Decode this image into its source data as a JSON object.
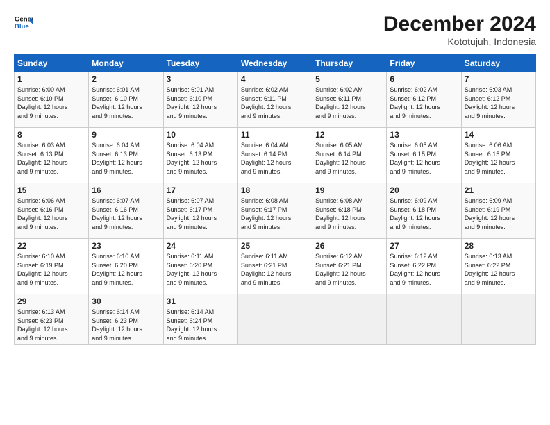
{
  "header": {
    "logo_line1": "General",
    "logo_line2": "Blue",
    "month": "December 2024",
    "location": "Kototujuh, Indonesia"
  },
  "days_of_week": [
    "Sunday",
    "Monday",
    "Tuesday",
    "Wednesday",
    "Thursday",
    "Friday",
    "Saturday"
  ],
  "weeks": [
    [
      {
        "num": "1",
        "sr": "6:00 AM",
        "ss": "6:10 PM",
        "dl": "12 hours and 9 minutes."
      },
      {
        "num": "2",
        "sr": "6:01 AM",
        "ss": "6:10 PM",
        "dl": "12 hours and 9 minutes."
      },
      {
        "num": "3",
        "sr": "6:01 AM",
        "ss": "6:10 PM",
        "dl": "12 hours and 9 minutes."
      },
      {
        "num": "4",
        "sr": "6:02 AM",
        "ss": "6:11 PM",
        "dl": "12 hours and 9 minutes."
      },
      {
        "num": "5",
        "sr": "6:02 AM",
        "ss": "6:11 PM",
        "dl": "12 hours and 9 minutes."
      },
      {
        "num": "6",
        "sr": "6:02 AM",
        "ss": "6:12 PM",
        "dl": "12 hours and 9 minutes."
      },
      {
        "num": "7",
        "sr": "6:03 AM",
        "ss": "6:12 PM",
        "dl": "12 hours and 9 minutes."
      }
    ],
    [
      {
        "num": "8",
        "sr": "6:03 AM",
        "ss": "6:13 PM",
        "dl": "12 hours and 9 minutes."
      },
      {
        "num": "9",
        "sr": "6:04 AM",
        "ss": "6:13 PM",
        "dl": "12 hours and 9 minutes."
      },
      {
        "num": "10",
        "sr": "6:04 AM",
        "ss": "6:13 PM",
        "dl": "12 hours and 9 minutes."
      },
      {
        "num": "11",
        "sr": "6:04 AM",
        "ss": "6:14 PM",
        "dl": "12 hours and 9 minutes."
      },
      {
        "num": "12",
        "sr": "6:05 AM",
        "ss": "6:14 PM",
        "dl": "12 hours and 9 minutes."
      },
      {
        "num": "13",
        "sr": "6:05 AM",
        "ss": "6:15 PM",
        "dl": "12 hours and 9 minutes."
      },
      {
        "num": "14",
        "sr": "6:06 AM",
        "ss": "6:15 PM",
        "dl": "12 hours and 9 minutes."
      }
    ],
    [
      {
        "num": "15",
        "sr": "6:06 AM",
        "ss": "6:16 PM",
        "dl": "12 hours and 9 minutes."
      },
      {
        "num": "16",
        "sr": "6:07 AM",
        "ss": "6:16 PM",
        "dl": "12 hours and 9 minutes."
      },
      {
        "num": "17",
        "sr": "6:07 AM",
        "ss": "6:17 PM",
        "dl": "12 hours and 9 minutes."
      },
      {
        "num": "18",
        "sr": "6:08 AM",
        "ss": "6:17 PM",
        "dl": "12 hours and 9 minutes."
      },
      {
        "num": "19",
        "sr": "6:08 AM",
        "ss": "6:18 PM",
        "dl": "12 hours and 9 minutes."
      },
      {
        "num": "20",
        "sr": "6:09 AM",
        "ss": "6:18 PM",
        "dl": "12 hours and 9 minutes."
      },
      {
        "num": "21",
        "sr": "6:09 AM",
        "ss": "6:19 PM",
        "dl": "12 hours and 9 minutes."
      }
    ],
    [
      {
        "num": "22",
        "sr": "6:10 AM",
        "ss": "6:19 PM",
        "dl": "12 hours and 9 minutes."
      },
      {
        "num": "23",
        "sr": "6:10 AM",
        "ss": "6:20 PM",
        "dl": "12 hours and 9 minutes."
      },
      {
        "num": "24",
        "sr": "6:11 AM",
        "ss": "6:20 PM",
        "dl": "12 hours and 9 minutes."
      },
      {
        "num": "25",
        "sr": "6:11 AM",
        "ss": "6:21 PM",
        "dl": "12 hours and 9 minutes."
      },
      {
        "num": "26",
        "sr": "6:12 AM",
        "ss": "6:21 PM",
        "dl": "12 hours and 9 minutes."
      },
      {
        "num": "27",
        "sr": "6:12 AM",
        "ss": "6:22 PM",
        "dl": "12 hours and 9 minutes."
      },
      {
        "num": "28",
        "sr": "6:13 AM",
        "ss": "6:22 PM",
        "dl": "12 hours and 9 minutes."
      }
    ],
    [
      {
        "num": "29",
        "sr": "6:13 AM",
        "ss": "6:23 PM",
        "dl": "12 hours and 9 minutes."
      },
      {
        "num": "30",
        "sr": "6:14 AM",
        "ss": "6:23 PM",
        "dl": "12 hours and 9 minutes."
      },
      {
        "num": "31",
        "sr": "6:14 AM",
        "ss": "6:24 PM",
        "dl": "12 hours and 9 minutes."
      },
      null,
      null,
      null,
      null
    ]
  ]
}
